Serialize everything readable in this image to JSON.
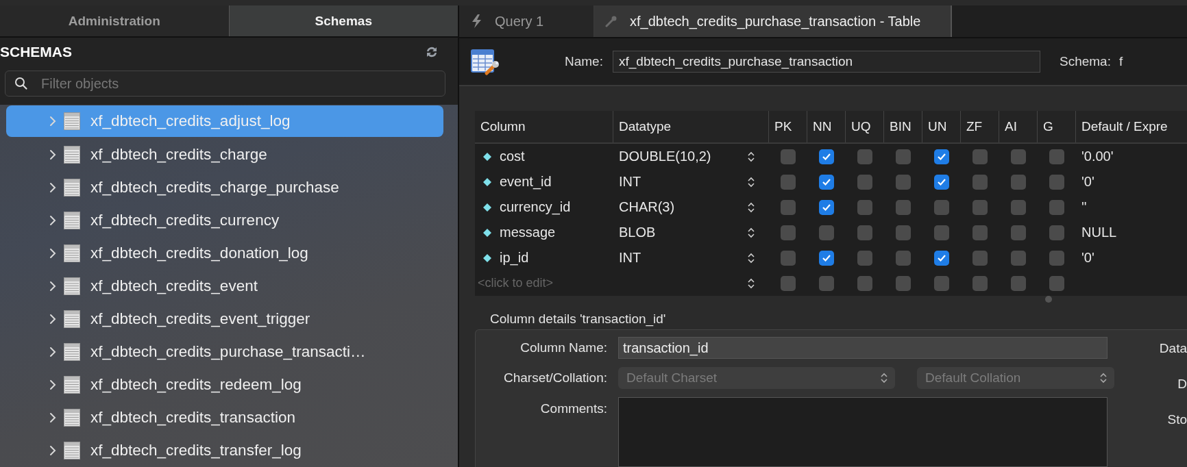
{
  "sidebar": {
    "tabs": [
      {
        "label": "Administration",
        "selected": false
      },
      {
        "label": "Schemas",
        "selected": true
      }
    ],
    "heading": "SCHEMAS",
    "filter": {
      "placeholder": "Filter objects"
    },
    "items": [
      {
        "label": "xf_dbtech_credits_adjust_log",
        "selected": true,
        "expanded": false
      },
      {
        "label": "xf_dbtech_credits_charge",
        "selected": false,
        "expanded": false
      },
      {
        "label": "xf_dbtech_credits_charge_purchase",
        "selected": false,
        "expanded": false
      },
      {
        "label": "xf_dbtech_credits_currency",
        "selected": false,
        "expanded": false
      },
      {
        "label": "xf_dbtech_credits_donation_log",
        "selected": false,
        "expanded": false
      },
      {
        "label": "xf_dbtech_credits_event",
        "selected": false,
        "expanded": false
      },
      {
        "label": "xf_dbtech_credits_event_trigger",
        "selected": false,
        "expanded": false
      },
      {
        "label": "xf_dbtech_credits_purchase_transacti…",
        "selected": false,
        "expanded": false
      },
      {
        "label": "xf_dbtech_credits_redeem_log",
        "selected": false,
        "expanded": false
      },
      {
        "label": "xf_dbtech_credits_transaction",
        "selected": false,
        "expanded": false
      },
      {
        "label": "xf_dbtech_credits_transfer_log",
        "selected": false,
        "expanded": false
      }
    ]
  },
  "editor_tabs": [
    {
      "label": "Query 1",
      "kind": "query",
      "selected": false
    },
    {
      "label": "xf_dbtech_credits_purchase_transaction - Table",
      "kind": "table",
      "selected": true
    }
  ],
  "table_editor": {
    "name_label": "Name:",
    "name": "xf_dbtech_credits_purchase_transaction",
    "schema_label": "Schema:",
    "schema": "f",
    "columns": [
      "Column",
      "Datatype",
      "PK",
      "NN",
      "UQ",
      "BIN",
      "UN",
      "ZF",
      "AI",
      "G",
      "Default / Expre"
    ],
    "rows": [
      {
        "name": "cost",
        "datatype": "DOUBLE(10,2)",
        "flags": [
          false,
          true,
          false,
          false,
          true,
          false,
          false,
          false
        ],
        "default": "'0.00'"
      },
      {
        "name": "event_id",
        "datatype": "INT",
        "flags": [
          false,
          true,
          false,
          false,
          true,
          false,
          false,
          false
        ],
        "default": "'0'"
      },
      {
        "name": "currency_id",
        "datatype": "CHAR(3)",
        "flags": [
          false,
          true,
          false,
          false,
          false,
          false,
          false,
          false
        ],
        "default": "''"
      },
      {
        "name": "message",
        "datatype": "BLOB",
        "flags": [
          false,
          false,
          false,
          false,
          false,
          false,
          false,
          false
        ],
        "default": "NULL"
      },
      {
        "name": "ip_id",
        "datatype": "INT",
        "flags": [
          false,
          true,
          false,
          false,
          true,
          false,
          false,
          false
        ],
        "default": "'0'"
      }
    ],
    "new_row": {
      "placeholder": "<click to edit>",
      "flags": [
        false,
        false,
        false,
        false,
        false,
        false,
        false,
        false
      ]
    }
  },
  "column_details": {
    "title": "Column details 'transaction_id'",
    "column_name_label": "Column Name:",
    "column_name": "transaction_id",
    "charset_label": "Charset/Collation:",
    "charset": {
      "value": "Default Charset",
      "disabled": true
    },
    "collation": {
      "value": "Default Collation",
      "disabled": true
    },
    "comments_label": "Comments:",
    "side_labels": [
      "Data",
      "D",
      "Sto"
    ]
  }
}
